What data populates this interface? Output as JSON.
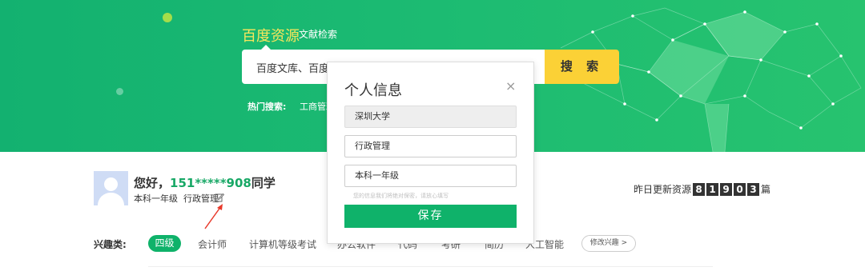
{
  "header": {
    "brand": "百度资源",
    "brand_sub": "文献检索",
    "search_text": "百度文库、百度学",
    "search_button": "搜 索",
    "hot_label": "热门搜索:",
    "hot_item": "工商管理"
  },
  "profile": {
    "greeting_prefix": "您好，",
    "phone": "151*****908",
    "greeting_suffix": "同学",
    "grade": "本科一年级",
    "major": "行政管理"
  },
  "update": {
    "label": "昨日更新资源",
    "digits": [
      "8",
      "1",
      "9",
      "0",
      "3"
    ],
    "unit": "篇"
  },
  "interests": {
    "label": "兴趣类:",
    "active_tag": "四级",
    "tags": [
      "会计师",
      "计算机等级考试",
      "办公软件",
      "代码",
      "考研",
      "简历",
      "人工智能"
    ],
    "edit_button": "修改兴趣 >"
  },
  "modal": {
    "title": "个人信息",
    "close": "×",
    "school": "深圳大学",
    "major": "行政管理",
    "grade": "本科一年级",
    "hint": "您的信息我们将绝对保密，请放心填写",
    "save": "保存"
  },
  "colors": {
    "accent": "#0fb26a",
    "search_button": "#fbd136",
    "brand": "#f8e65c"
  }
}
